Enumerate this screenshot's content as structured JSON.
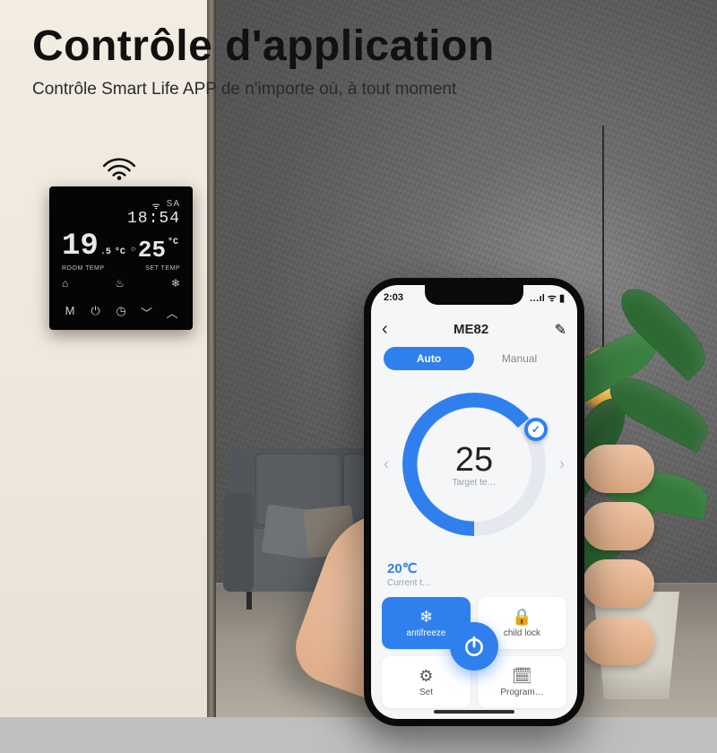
{
  "headline": {
    "title": "Contrôle d'application",
    "subtitle": "Contrôle Smart Life APP de n'importe où, à tout moment"
  },
  "thermostat": {
    "day": "SA",
    "time": "18:54",
    "room_temp": "19",
    "room_dec": ".5",
    "unit": "°C",
    "set_temp": "25",
    "label_room": "ROOM TEMP",
    "label_set": "SET TEMP",
    "buttons": {
      "menu": "M",
      "power": "⏻",
      "clock": "◷",
      "down": "﹀",
      "up": "︿"
    }
  },
  "phone": {
    "status": {
      "time": "2:03",
      "carrier_icons": "…ıl ᯤ ▮"
    },
    "header": {
      "title": "ME82",
      "back": "‹",
      "edit": "✎"
    },
    "modes": {
      "auto": "Auto",
      "manual": "Manual"
    },
    "dial": {
      "target_temp": "25",
      "target_label": "Target te…"
    },
    "current": {
      "value": "20℃",
      "label": "Current t…"
    },
    "tiles": {
      "antifreeze": "antifreeze",
      "childlock": "child lock",
      "set": "Set",
      "program": "Program…"
    }
  }
}
